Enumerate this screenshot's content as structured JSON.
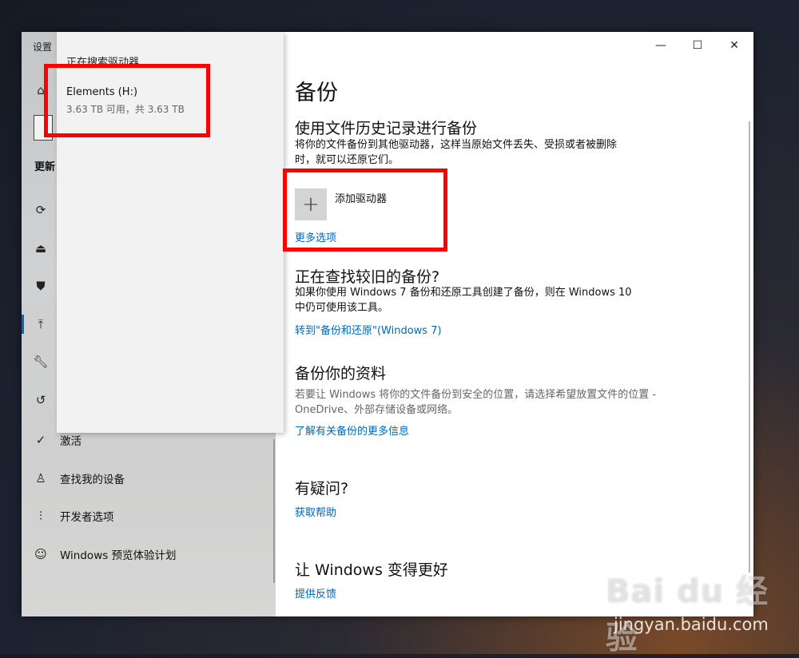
{
  "window": {
    "app_title": "设置",
    "titlebar": {
      "minimize": "—",
      "maximize": "☐",
      "close": "✕"
    }
  },
  "sidebar": {
    "heading": "更新",
    "icons": [
      "home-icon",
      "sync-icon",
      "delivery-icon",
      "shield-icon",
      "backup-arrow-icon",
      "wrench-icon",
      "history-icon"
    ],
    "items": [
      {
        "label": "激活",
        "icon": "check-circle-icon"
      },
      {
        "label": "查找我的设备",
        "icon": "person-location-icon"
      },
      {
        "label": "开发者选项",
        "icon": "developer-sliders-icon"
      },
      {
        "label": "Windows 预览体验计划",
        "icon": "insider-cat-icon"
      }
    ]
  },
  "dropdown": {
    "status": "正在搜索驱动器",
    "drive_name": "Elements (H:)",
    "drive_info": "3.63 TB 可用，共 3.63 TB"
  },
  "main": {
    "title": "备份",
    "file_history": {
      "heading": "使用文件历史记录进行备份",
      "desc_line1": "将你的文件备份到其他驱动器，这样当原始文件丢失、受损或者被删除",
      "desc_line2": "时，就可以还原它们。",
      "add_drive": "添加驱动器",
      "more_options": "更多选项"
    },
    "older_backup": {
      "heading": "正在查找较旧的备份?",
      "desc_line1": "如果你使用 Windows 7 备份和还原工具创建了备份，则在 Windows 10",
      "desc_line2": "中仍可使用该工具。",
      "link": "转到\"备份和还原\"(Windows 7)"
    },
    "backup_data": {
      "heading": "备份你的资料",
      "desc_line1": "若要让 Windows 将你的文件备份到安全的位置，请选择希望放置文件的位置 -",
      "desc_line2": "OneDrive、外部存储设备或网络。",
      "link": "了解有关备份的更多信息"
    },
    "questions": {
      "heading": "有疑问?",
      "link": "获取帮助"
    },
    "feedback": {
      "heading": "让 Windows 变得更好",
      "link": "提供反馈"
    }
  },
  "watermark": {
    "logo": "Bai du 经验",
    "url": "jingyan.baidu.com"
  },
  "colors": {
    "accent": "#0067b8",
    "highlight": "#ff0000",
    "sidebar_bg": "#cfcfcf"
  }
}
